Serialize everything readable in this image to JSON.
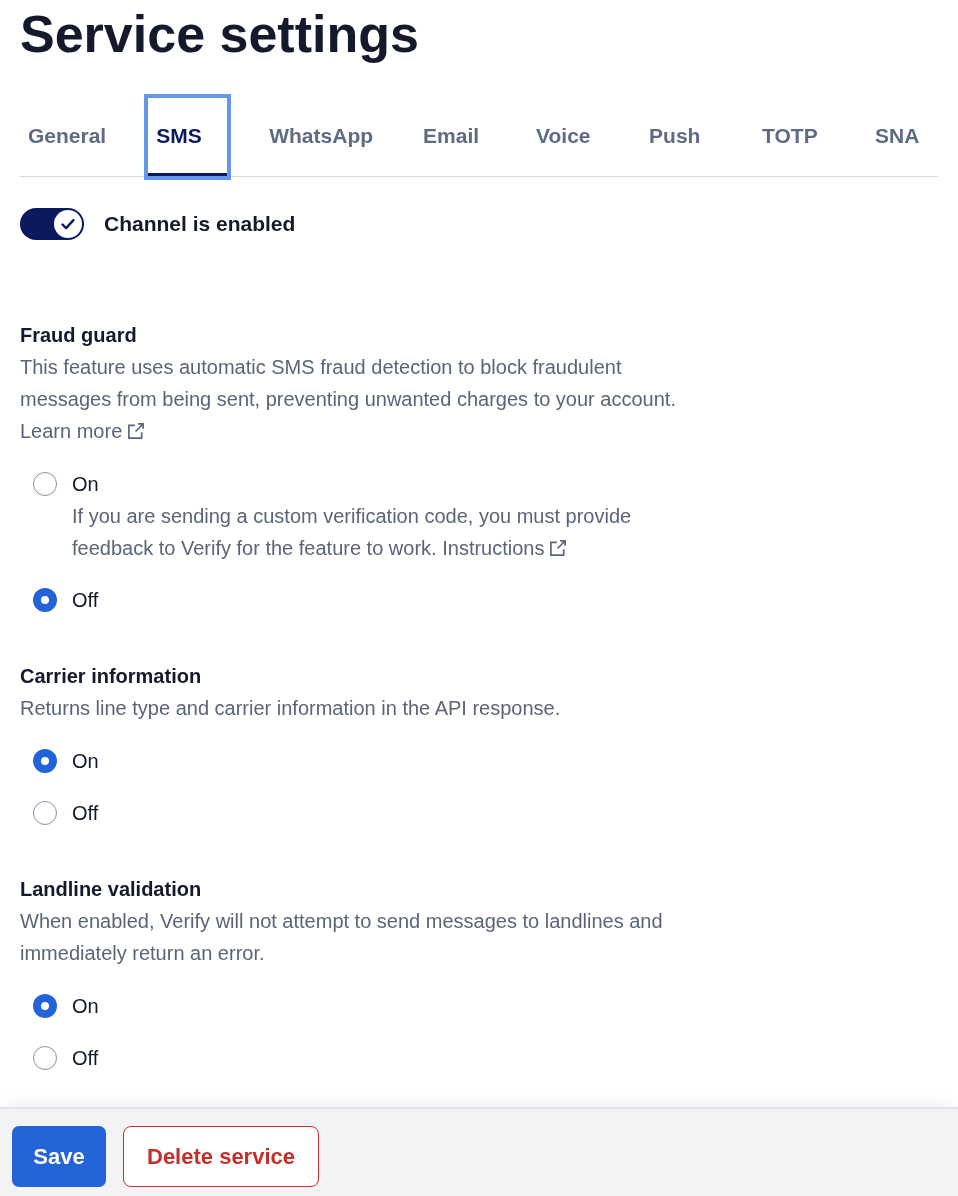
{
  "title": "Service settings",
  "tabs": [
    {
      "label": "General",
      "selected": false,
      "focused": false
    },
    {
      "label": "SMS",
      "selected": true,
      "focused": true
    },
    {
      "label": "WhatsApp",
      "selected": false,
      "focused": false
    },
    {
      "label": "Email",
      "selected": false,
      "focused": false
    },
    {
      "label": "Voice",
      "selected": false,
      "focused": false
    },
    {
      "label": "Push",
      "selected": false,
      "focused": false
    },
    {
      "label": "TOTP",
      "selected": false,
      "focused": false
    },
    {
      "label": "SNA",
      "selected": false,
      "focused": false
    }
  ],
  "channel_toggle": {
    "label": "Channel is enabled",
    "on": true
  },
  "sections": [
    {
      "heading": "Fraud guard",
      "description": "This feature uses automatic SMS fraud detection to block fraudulent messages from being sent, preventing unwanted charges to your account.",
      "link": "Learn more",
      "options": [
        {
          "label": "On",
          "selected": false,
          "help": "If you are sending a custom verification code, you must provide feedback to Verify for the feature to work.",
          "help_link": "Instructions"
        },
        {
          "label": "Off",
          "selected": true
        }
      ]
    },
    {
      "heading": "Carrier information",
      "description": "Returns line type and carrier information in the API response.",
      "options": [
        {
          "label": "On",
          "selected": true
        },
        {
          "label": "Off",
          "selected": false
        }
      ]
    },
    {
      "heading": "Landline validation",
      "description": "When enabled, Verify will not attempt to send messages to landlines and immediately return an error.",
      "options": [
        {
          "label": "On",
          "selected": true
        },
        {
          "label": "Off",
          "selected": false
        }
      ]
    }
  ],
  "footer": {
    "buttons": [
      {
        "label": "Save",
        "kind": "primary"
      },
      {
        "label": "Delete service",
        "kind": "danger"
      }
    ]
  }
}
